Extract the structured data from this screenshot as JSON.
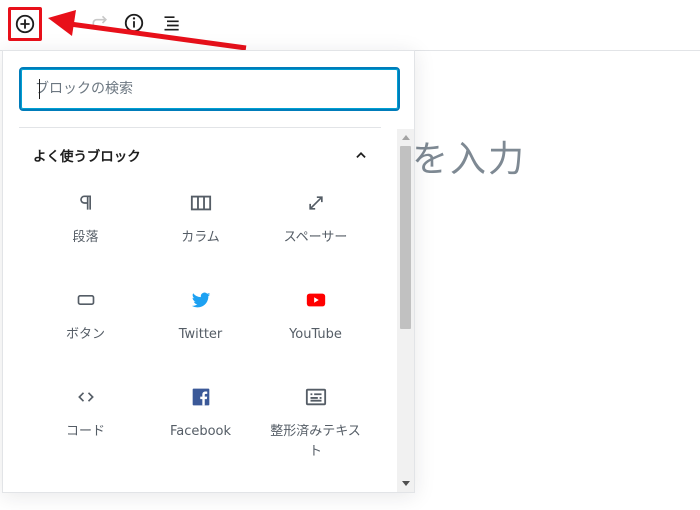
{
  "editor": {
    "title_fragment": "を入力"
  },
  "inserter": {
    "search": {
      "placeholder": "ブロックの検索",
      "value": ""
    },
    "panel": {
      "title": "よく使うブロック"
    },
    "blocks": [
      {
        "label": "段落",
        "icon": "paragraph-icon"
      },
      {
        "label": "カラム",
        "icon": "columns-icon"
      },
      {
        "label": "スペーサー",
        "icon": "resize-icon"
      },
      {
        "label": "ボタン",
        "icon": "button-icon"
      },
      {
        "label": "Twitter",
        "icon": "twitter-icon"
      },
      {
        "label": "YouTube",
        "icon": "youtube-icon"
      },
      {
        "label": "コード",
        "icon": "code-icon"
      },
      {
        "label": "Facebook",
        "icon": "facebook-icon"
      },
      {
        "label": "整形済みテキスト",
        "icon": "preformatted-icon"
      }
    ]
  },
  "colors": {
    "highlight": "#e8101a",
    "focus": "#007cba",
    "twitter": "#1da1f2",
    "youtube": "#ff0000",
    "facebook": "#3b5998"
  }
}
